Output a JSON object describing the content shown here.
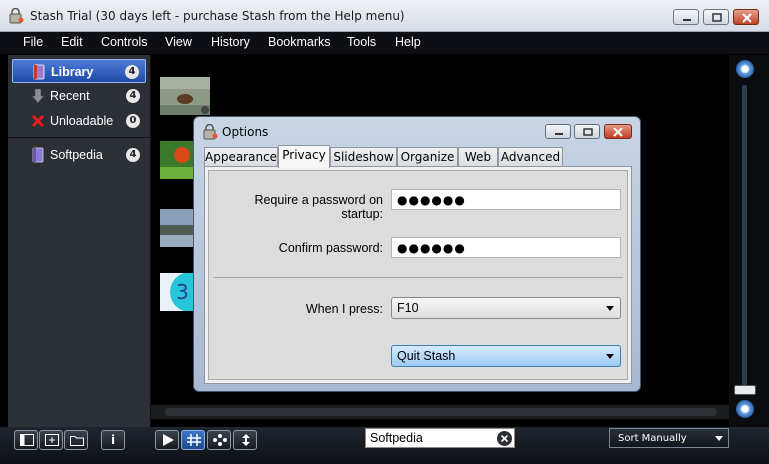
{
  "window": {
    "title": "Stash Trial (30 days left - purchase Stash from the Help menu)"
  },
  "menu": [
    "File",
    "Edit",
    "Controls",
    "View",
    "History",
    "Bookmarks",
    "Tools",
    "Help"
  ],
  "sidebar": {
    "items": [
      {
        "label": "Library",
        "count": "4",
        "icon": "library-book-icon",
        "selected": true
      },
      {
        "label": "Recent",
        "count": "4",
        "icon": "down-arrow-icon",
        "selected": false
      },
      {
        "label": "Unloadable",
        "count": "0",
        "icon": "red-x-icon",
        "selected": false
      },
      {
        "label": "Softpedia",
        "count": "4",
        "icon": "collection-book-icon",
        "selected": false
      }
    ]
  },
  "bottom": {
    "search_value": "Softpedia",
    "sort_label": "Sort Manually",
    "info_label": "i"
  },
  "dialog": {
    "title": "Options",
    "tabs": [
      "Appearance",
      "Privacy",
      "Slideshow",
      "Organize",
      "Web",
      "Advanced"
    ],
    "active_tab": "Privacy",
    "password_label": "Require a password on startup:",
    "password_value": "●●●●●●",
    "confirm_label": "Confirm password:",
    "confirm_value": "●●●●●●",
    "when_press_label": "When I press:",
    "key_value": "F10",
    "action_value": "Quit Stash"
  },
  "colors": {
    "selection": "#2b5fb8",
    "sidebar_bg": "#2b3036",
    "dialog_frame": "#b7c8de"
  }
}
